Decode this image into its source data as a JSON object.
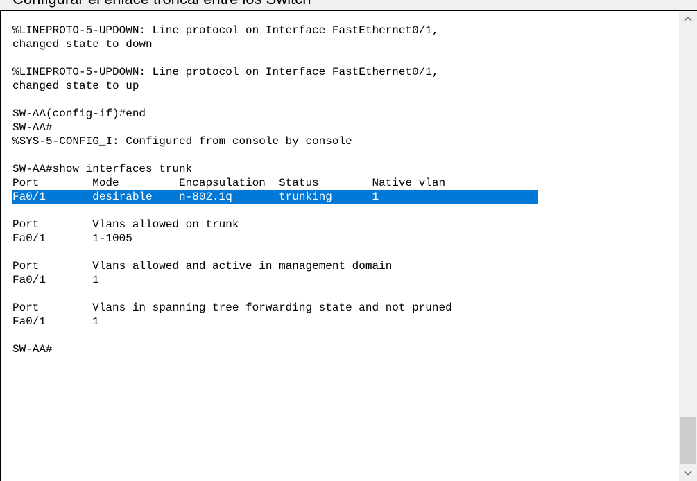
{
  "window": {
    "clipped_title": "Configurar el enlace troncal entre los Switch"
  },
  "console": {
    "lines": [
      "%LINEPROTO-5-UPDOWN: Line protocol on Interface FastEthernet0/1,",
      "changed state to down",
      "",
      "%LINEPROTO-5-UPDOWN: Line protocol on Interface FastEthernet0/1,",
      "changed state to up",
      "",
      "SW-AA(config-if)#end",
      "SW-AA#",
      "%SYS-5-CONFIG_I: Configured from console by console",
      "",
      "SW-AA#show interfaces trunk",
      "Port        Mode         Encapsulation  Status        Native vlan",
      "Fa0/1       desirable    n-802.1q       trunking      1",
      "",
      "Port        Vlans allowed on trunk",
      "Fa0/1       1-1005",
      "",
      "Port        Vlans allowed and active in management domain",
      "Fa0/1       1",
      "",
      "Port        Vlans in spanning tree forwarding state and not pruned",
      "Fa0/1       1",
      "",
      "SW-AA#"
    ],
    "selected_line_index": 12,
    "selection_color": "#0078d7"
  },
  "scrollbar": {
    "up_icon": "chevron-up-icon",
    "down_icon": "chevron-down-icon"
  }
}
